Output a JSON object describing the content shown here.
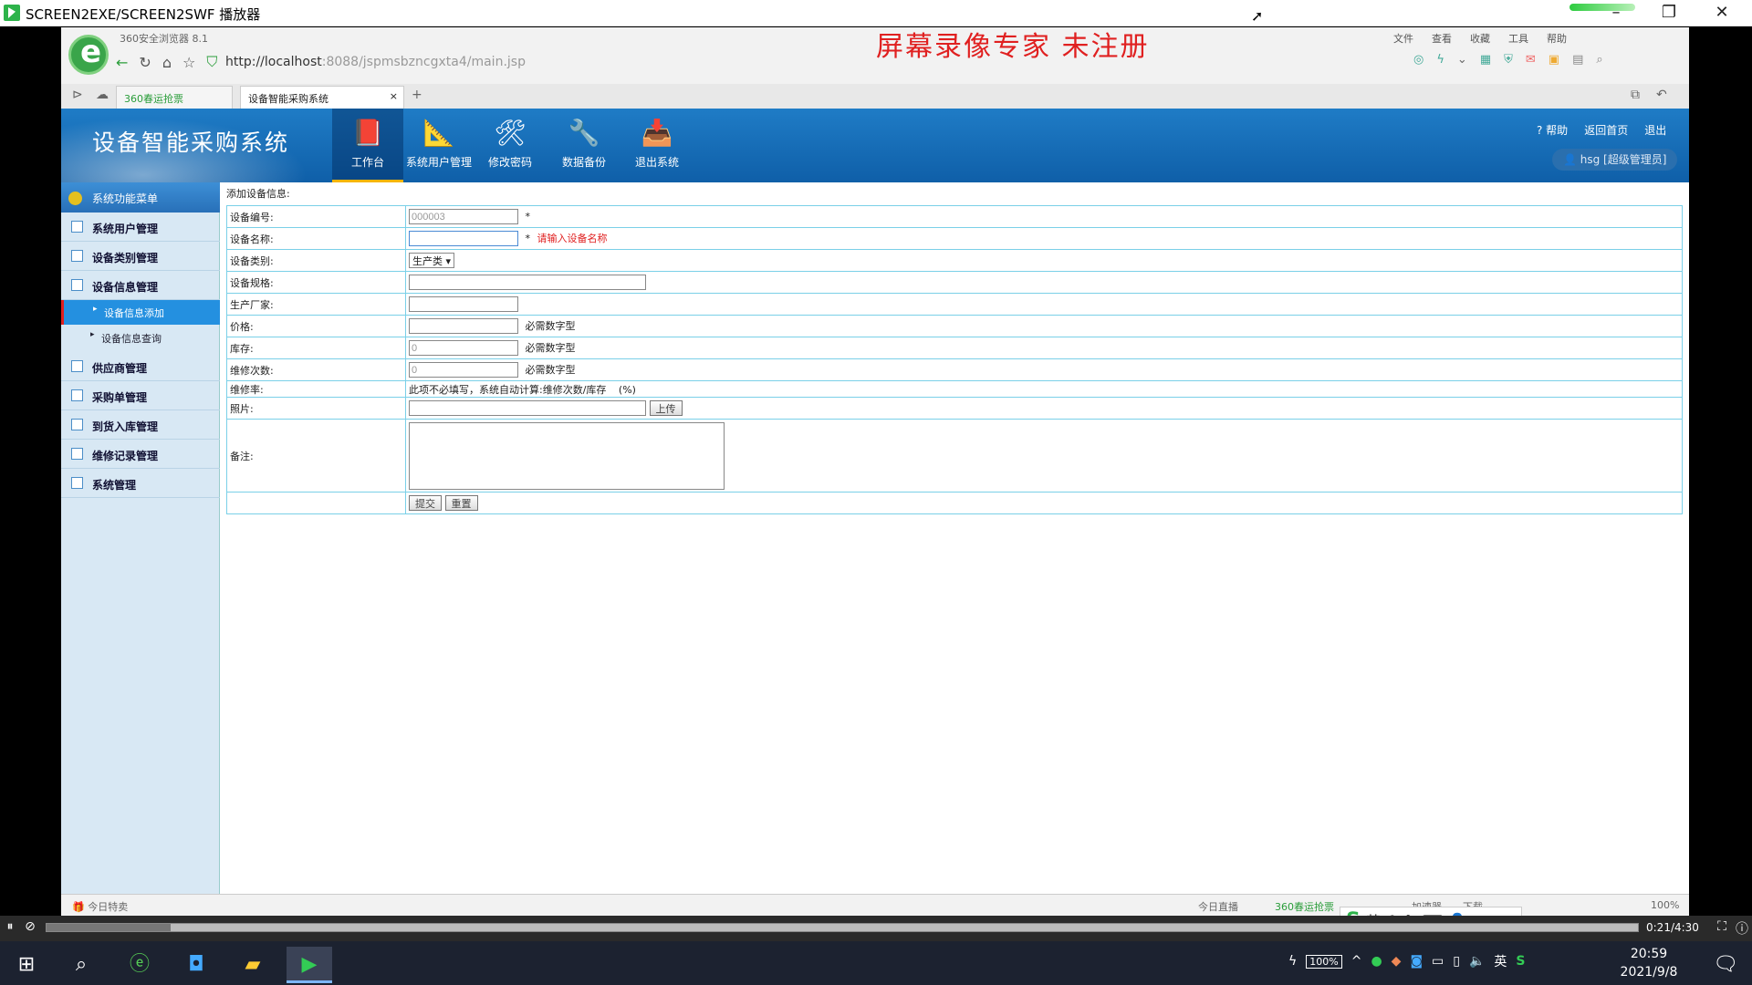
{
  "player": {
    "title": "SCREEN2EXE/SCREEN2SWF 播放器",
    "window_controls": [
      "–",
      "❐",
      "✕"
    ],
    "time": "0:21/4:30",
    "progress": 0.078
  },
  "browser": {
    "version": "360安全浏览器 8.1",
    "watermark": "屏幕录像专家  未注册",
    "menu": [
      "文件",
      "查看",
      "收藏",
      "工具",
      "帮助"
    ],
    "url_host": "http://localhost",
    "url_rest": ":8088/jspmsbzncgxta4/main.jsp",
    "tabs": [
      {
        "label": "360春运抢票"
      },
      {
        "label": "设备智能采购系统"
      }
    ],
    "status_left": "今日特卖",
    "status_right": [
      "今日直播",
      "360春运抢票",
      "加速器",
      "下载",
      "100%"
    ]
  },
  "app": {
    "title": "设备智能采购系统",
    "nav": [
      {
        "label": "工作台",
        "icon": "book-icon",
        "glyph": "📕"
      },
      {
        "label": "系统用户管理",
        "icon": "ruler-icon",
        "glyph": "📐"
      },
      {
        "label": "修改密码",
        "icon": "tools-icon",
        "glyph": "🛠"
      },
      {
        "label": "数据备份",
        "icon": "wrench-icon",
        "glyph": "🔧"
      },
      {
        "label": "退出系统",
        "icon": "folder-download-icon",
        "glyph": "📥"
      }
    ],
    "top_links": [
      "? 帮助",
      "返回首页",
      "退出"
    ],
    "user": "hsg [超级管理员]"
  },
  "sidebar": {
    "header": "系统功能菜单",
    "items": [
      {
        "label": "系统用户管理"
      },
      {
        "label": "设备类别管理"
      },
      {
        "label": "设备信息管理"
      },
      {
        "label": "供应商管理"
      },
      {
        "label": "采购单管理"
      },
      {
        "label": "到货入库管理"
      },
      {
        "label": "维修记录管理"
      },
      {
        "label": "系统管理"
      }
    ],
    "subitems": [
      {
        "label": "设备信息添加"
      },
      {
        "label": "设备信息查询"
      }
    ]
  },
  "form": {
    "breadcrumb": "添加设备信息:",
    "fields": {
      "code": {
        "label": "设备编号:",
        "value": "000003",
        "mark": "*"
      },
      "name": {
        "label": "设备名称:",
        "value": "",
        "mark": "*",
        "error": "请输入设备名称"
      },
      "category": {
        "label": "设备类别:",
        "value": "生产类"
      },
      "spec": {
        "label": "设备规格:",
        "value": ""
      },
      "maker": {
        "label": "生产厂家:",
        "value": ""
      },
      "price": {
        "label": "价格:",
        "value": "",
        "hint": "必需数字型"
      },
      "stock": {
        "label": "库存:",
        "value": "0",
        "hint": "必需数字型"
      },
      "repairs": {
        "label": "维修次数:",
        "value": "0",
        "hint": "必需数字型"
      },
      "rate": {
        "label": "维修率:",
        "text": "此项不必填写，系统自动计算:维修次数/库存",
        "unit": "(%)"
      },
      "photo": {
        "label": "照片:",
        "value": "",
        "button": "上传"
      },
      "remark": {
        "label": "备注:",
        "value": ""
      }
    },
    "submit": "提交",
    "reset": "重置"
  },
  "taskbar": {
    "battery": "100%",
    "lang": "英",
    "time": "20:59",
    "date": "2021/9/8"
  },
  "ime": {
    "mode": "英"
  }
}
